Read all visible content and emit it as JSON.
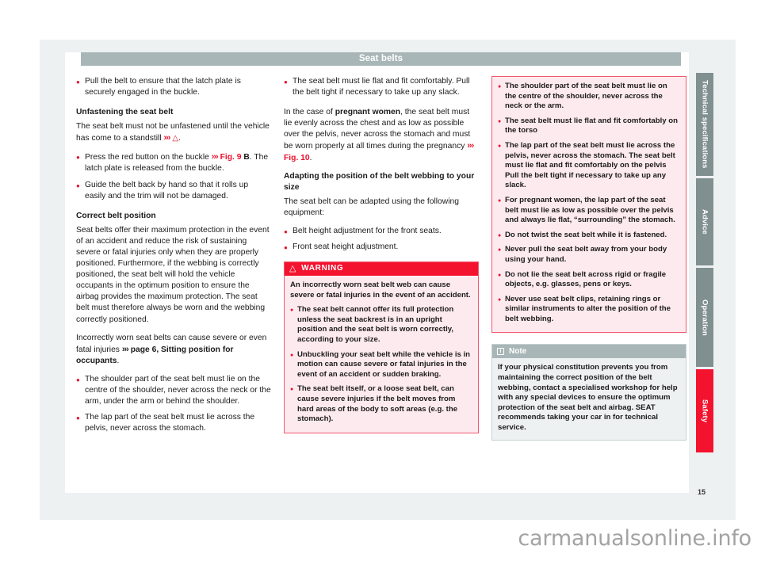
{
  "document": {
    "section_title": "Seat belts",
    "page_number": "15",
    "watermark": "carmanualsonline.info"
  },
  "side_tabs": [
    {
      "label": "Technical specifications",
      "active": false
    },
    {
      "label": "Advice",
      "active": false
    },
    {
      "label": "Operation",
      "active": false
    },
    {
      "label": "Safety",
      "active": true
    }
  ],
  "column_1": {
    "bullet_1": "Pull the belt to ensure that the latch plate is securely engaged in the buckle.",
    "heading_unfastening": "Unfastening the seat belt",
    "para_unfastening_a": "The seat belt must not be unfastened until",
    "para_unfastening_b": "the vehicle has come to a standstill",
    "ref_chevron": "›››",
    "bullet_2_a": "Press the red button on the buckle",
    "bullet_2_ref": "Fig. 9",
    "bullet_2_b": "B",
    "bullet_2_c": ". The latch plate is released from the buckle.",
    "bullet_3": "Guide the belt back by hand so that it rolls up easily and the trim will not be damaged.",
    "heading_correct": "Correct belt position",
    "para_correct": "Seat belts offer their maximum protection in the event of an accident and reduce the risk of sustaining severe or fatal injuries only when they are properly positioned. Furthermore, if the webbing is correctly positioned, the seat belt will hold the vehicle occupants in the optimum position to ensure the airbag provides the maximum protection. The seat belt must therefore always be worn and the webbing correctly positioned.",
    "para_incorrect_a": "Incorrectly worn seat belts can cause severe or even fatal injuries",
    "para_incorrect_ref": "page 6, Sitting position for occupants",
    "para_incorrect_end": ".",
    "bullet_4": "The shoulder part of the seat belt must lie on the centre of the shoulder, never across the neck or the arm, under the arm or behind the shoulder.",
    "bullet_5": "The lap part of the seat belt must lie across the pelvis, never across the stomach."
  },
  "column_2": {
    "bullet_1": "The seat belt must lie flat and fit comfortably. Pull the belt tight if necessary to take up any slack.",
    "para_pregnant_a": "In the case of ",
    "para_pregnant_bold": "pregnant women",
    "para_pregnant_b": ", the seat belt must lie evenly across the chest and as low as possible over the pelvis, never across the stomach and must be worn properly at all times during the pregnancy",
    "para_pregnant_ref": "Fig. 10",
    "para_pregnant_end": ".",
    "heading_adapting": "Adapting the position of the belt webbing to your size",
    "para_adapting": "The seat belt can be adapted using the following equipment:",
    "bullet_2": "Belt height adjustment for the front seats.",
    "bullet_3": "Front seat height adjustment.",
    "warning": {
      "title": "WARNING",
      "icon": "warning-triangle",
      "intro": "An incorrectly worn seat belt web can cause severe or fatal injuries in the event of an accident.",
      "bullets": [
        "The seat belt cannot offer its full protection unless the seat backrest is in an upright position and the seat belt is worn correctly, according to your size.",
        "Unbuckling your seat belt while the vehicle is in motion can cause severe or fatal injuries in the event of an accident or sudden braking.",
        "The seat belt itself, or a loose seat belt, can cause severe injuries if the belt moves from hard areas of the body to soft areas (e.g. the stomach)."
      ]
    }
  },
  "column_3": {
    "warning_bullets": [
      "The shoulder part of the seat belt must lie on the centre of the shoulder, never across the neck or the arm.",
      "The seat belt must lie flat and fit comfortably on the torso",
      "The lap part of the seat belt must lie across the pelvis, never across the stomach. The seat belt must lie flat and fit comfortably on the pelvis Pull the belt tight if necessary to take up any slack.",
      "For pregnant women, the lap part of the seat belt must lie as low as possible over the pelvis and always lie flat, “surrounding” the stomach.",
      "Do not twist the seat belt while it is fastened.",
      "Never pull the seat belt away from your body using your hand.",
      "Do not lie the seat belt across rigid or fragile objects, e.g. glasses, pens or keys.",
      "Never use seat belt clips, retaining rings or similar instruments to alter the position of the belt webbing."
    ],
    "note": {
      "title": "Note",
      "icon": "info-icon",
      "body": "If your physical constitution prevents you from maintaining the correct position of the belt webbing, contact a specialised workshop for help with any special devices to ensure the optimum protection of the seat belt and airbag. SEAT recommends taking your car in for technical service."
    }
  },
  "colors": {
    "brand_red": "#e8112d",
    "warning_red": "#f3132f",
    "warning_bg": "#fdeaee",
    "header_grey": "#a9b6b7",
    "tab_grey": "#808f90",
    "page_bg": "#eef1f2"
  }
}
